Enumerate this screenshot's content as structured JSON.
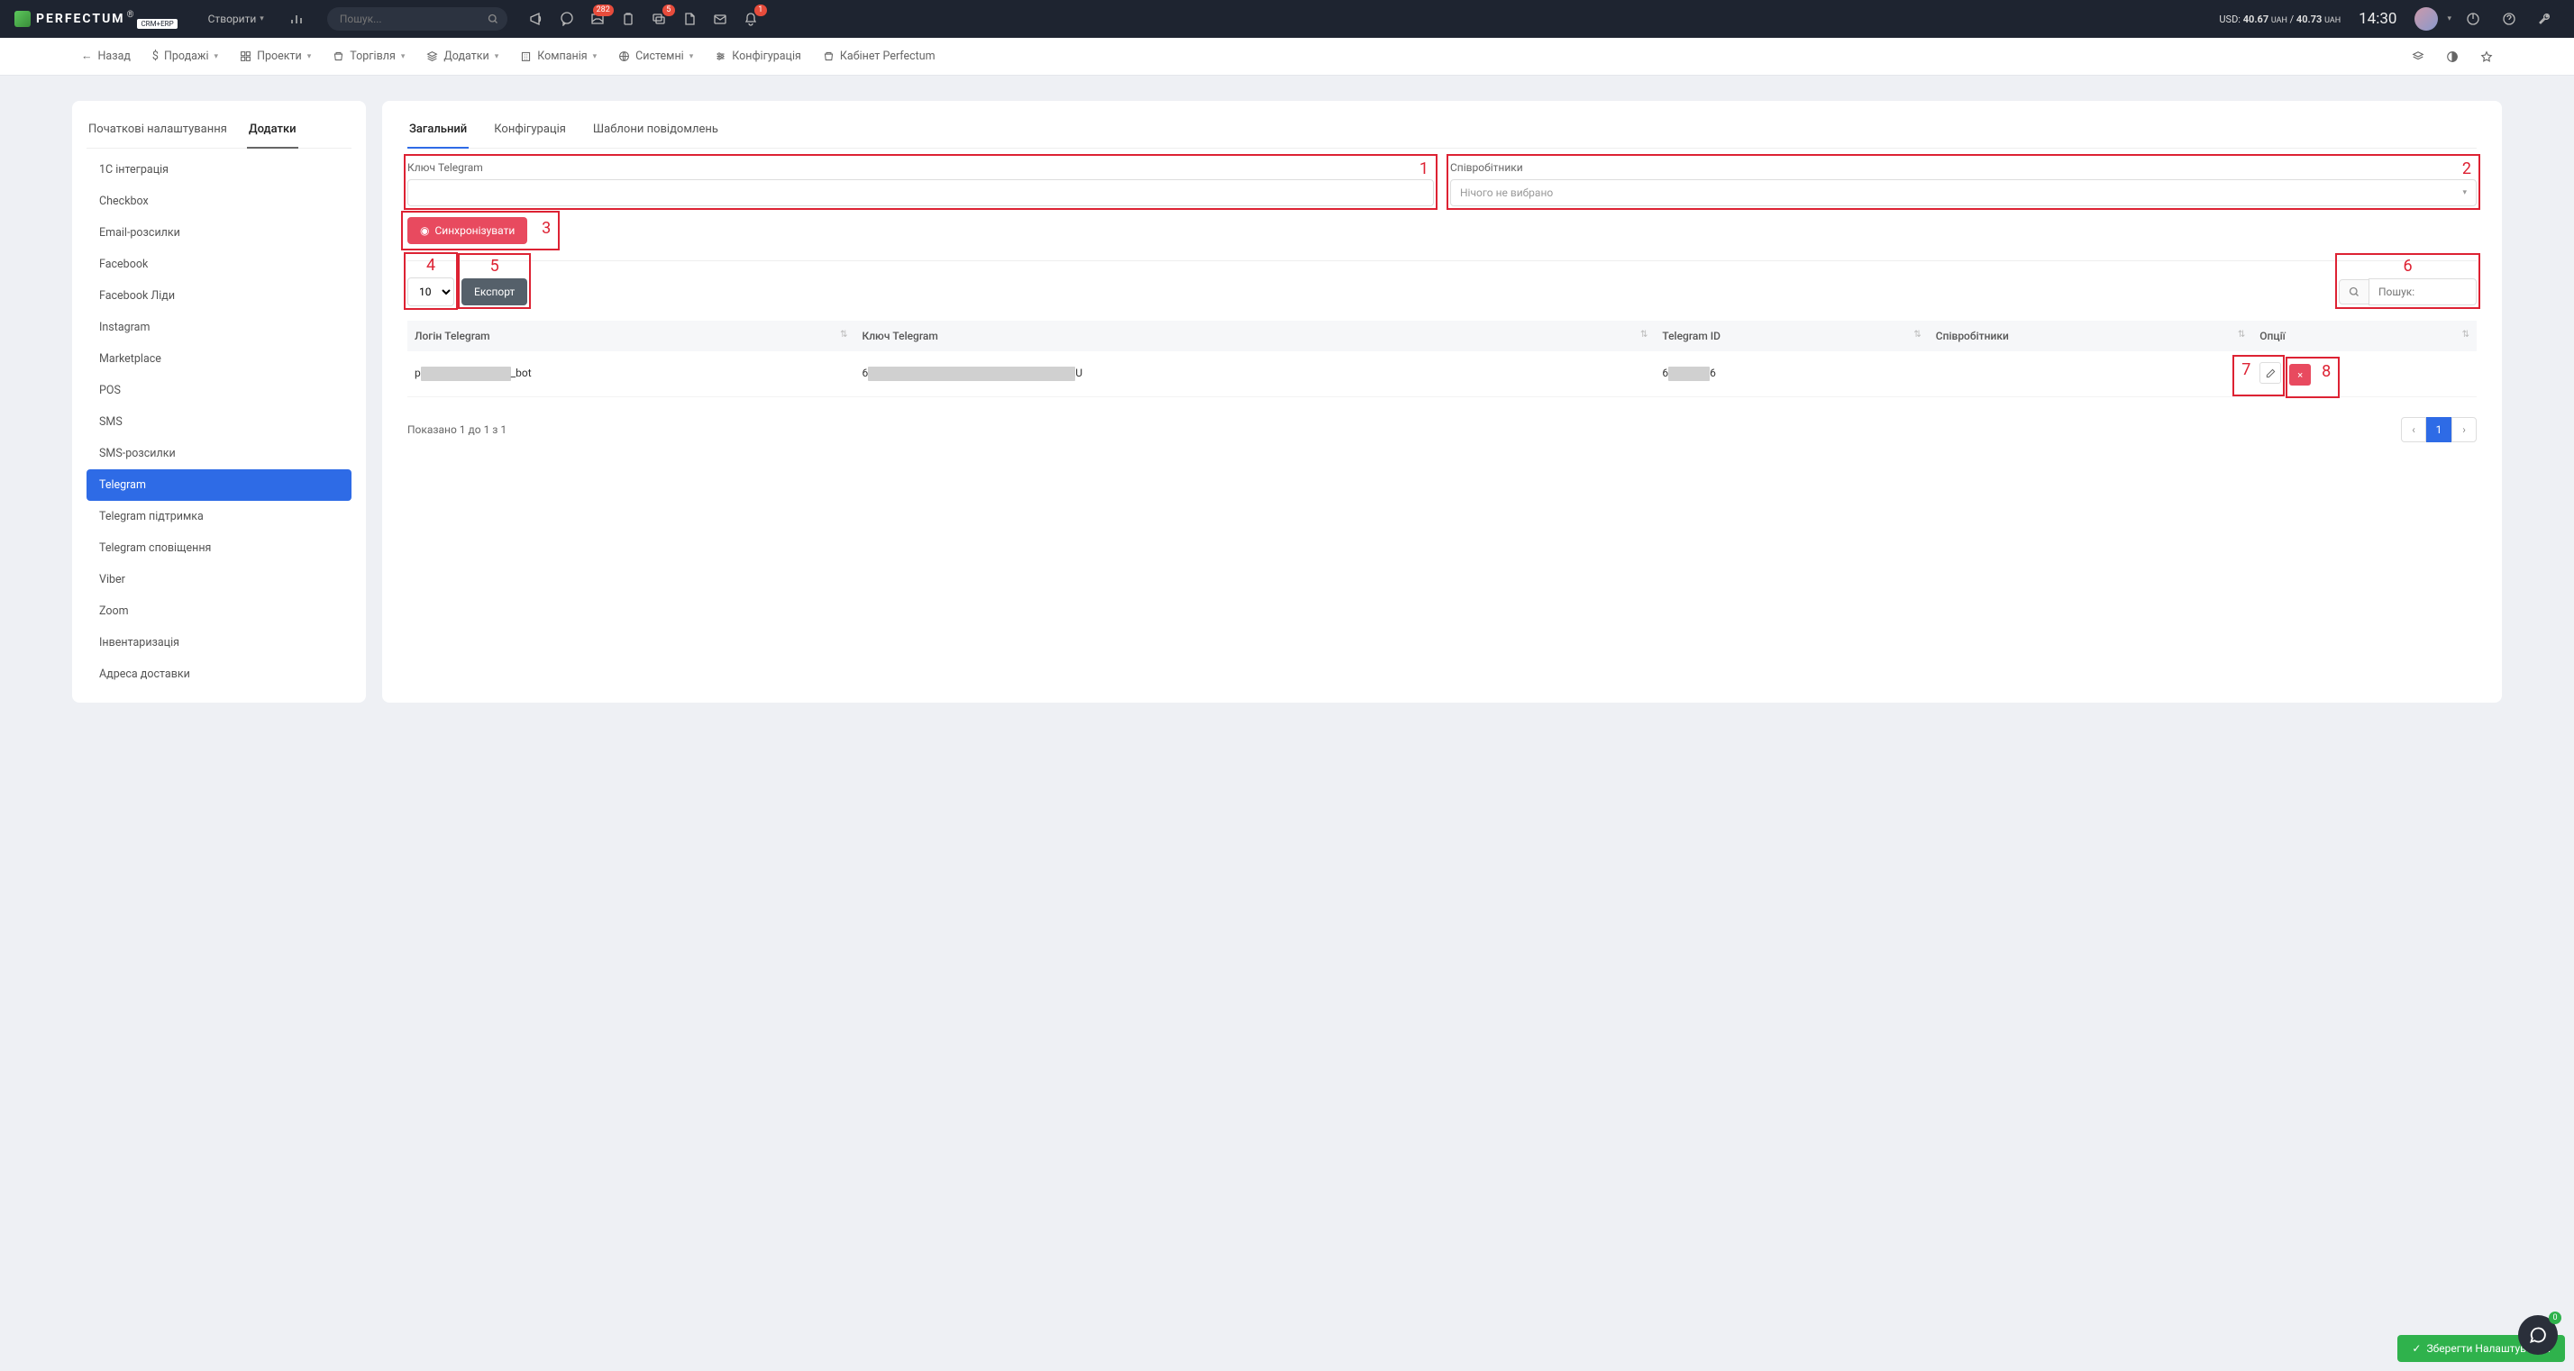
{
  "topbar": {
    "logo_text": "PERFECTUM",
    "logo_sub": "CRM+ERP",
    "create_label": "Створити",
    "search_placeholder": "Пошук...",
    "badges": {
      "inbox": "282",
      "chat": "5",
      "bell": "1"
    },
    "rate_prefix": "USD:",
    "rate_buy": "40.67",
    "rate_sep": "/",
    "rate_sell": "40.73",
    "rate_cur": "UAH",
    "clock": "14:30"
  },
  "menubar": {
    "back": "Назад",
    "items": [
      "Продажі",
      "Проекти",
      "Торгівля",
      "Додатки",
      "Компанія",
      "Системні",
      "Конфігурація",
      "Кабінет Perfectum"
    ]
  },
  "sidebar": {
    "tabs": [
      "Початкові налаштування",
      "Додатки"
    ],
    "items": [
      "1С інтеграція",
      "Checkbox",
      "Email-розсилки",
      "Facebook",
      "Facebook Ліди",
      "Instagram",
      "Marketplace",
      "POS",
      "SMS",
      "SMS-розсилки",
      "Telegram",
      "Telegram підтримка",
      "Telegram сповіщення",
      "Viber",
      "Zoom",
      "Інвентаризація",
      "Адреса доставки"
    ]
  },
  "main": {
    "tabs": [
      "Загальний",
      "Конфігурація",
      "Шаблони повідомлень"
    ],
    "form": {
      "key_label": "Ключ Telegram",
      "staff_label": "Співробітники",
      "staff_placeholder": "Нічого не вибрано",
      "sync_label": "Синхронізувати"
    },
    "controls": {
      "page_size": "10",
      "export_label": "Експорт",
      "search_placeholder": "Пошук:"
    },
    "table": {
      "headers": [
        "Логін Telegram",
        "Ключ Telegram",
        "Telegram ID",
        "Співробітники",
        "Опції"
      ],
      "row": {
        "login_p": "p",
        "login_s": "_bot",
        "key_p": "6",
        "key_s": "U",
        "id_p": "6",
        "id_s": "6",
        "staff": ""
      }
    },
    "footer": {
      "info": "Показано 1 до 1 з 1",
      "page": "1"
    }
  },
  "annotations": [
    "1",
    "2",
    "3",
    "4",
    "5",
    "6",
    "7",
    "8"
  ],
  "save_label": "Зберегти Налаштування",
  "chat_badge": "0"
}
